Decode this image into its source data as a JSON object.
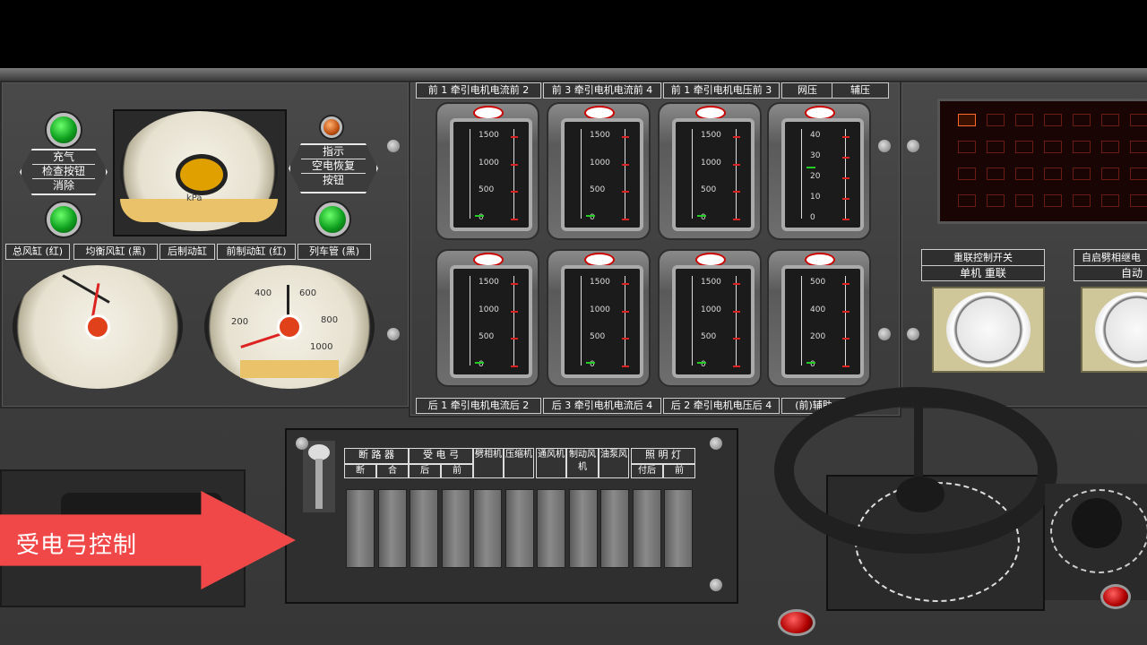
{
  "left_panel": {
    "charge_button": {
      "line1": "充气",
      "line2": "检查按钮",
      "line3": "消除"
    },
    "indicator_button": {
      "line1": "指示",
      "line2": "空电恢复",
      "line3": "按钮"
    },
    "gauge_labels": [
      "总风缸 (红)",
      "均衡风缸 (黑)",
      "后制动缸",
      "前制动缸 (红)",
      "列车管 (黑)"
    ],
    "top_gauge_unit": "kPa",
    "gauge_ticks": [
      "400",
      "600",
      "200",
      "800",
      "1000"
    ]
  },
  "meters": {
    "top_labels": [
      "前 1 牵引电机电流前 2",
      "前 3 牵引电机电流前 4",
      "前 1 牵引电机电压前 3",
      "网压",
      "辅压"
    ],
    "bottom_labels": [
      "后 1 牵引电机电流后 2",
      "后 3 牵引电机电流后 4",
      "后 2 牵引电机电压后 4",
      "(前)辅助"
    ],
    "scale_current": [
      "1500",
      "1000",
      "500",
      "0"
    ],
    "scale_voltage": [
      "1500",
      "1000",
      "500",
      "0"
    ],
    "scale_netpressure": [
      "40",
      "30",
      "20",
      "10",
      "0"
    ],
    "scale_aux": [
      "500",
      "400",
      "200",
      "0"
    ]
  },
  "switch_panel": {
    "group_labels": [
      "断 路 器",
      "受 电 弓",
      "劈相机",
      "压缩机",
      "通风机",
      "制动风机",
      "油泵风",
      "照 明 灯"
    ],
    "sub_labels": [
      "断",
      "合",
      "后",
      "前",
      "付后",
      "前"
    ]
  },
  "right_panel": {
    "coupling_switch": {
      "title": "重联控制开关",
      "options": "单机   重联"
    },
    "split_phase": {
      "title": "自启劈相继电",
      "option": "自动"
    }
  },
  "overlay": {
    "callout": "受电弓控制"
  },
  "colors": {
    "accent_arrow": "#f04848",
    "lamp_green": "#18c028",
    "panel": "#3f3f3f"
  }
}
